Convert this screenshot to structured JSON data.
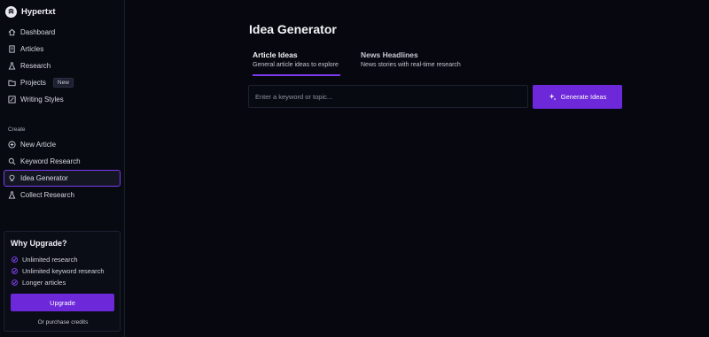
{
  "app": {
    "name": "Hypertxt"
  },
  "sidebar": {
    "main_items": [
      {
        "label": "Dashboard",
        "icon": "home-icon"
      },
      {
        "label": "Articles",
        "icon": "document-icon"
      },
      {
        "label": "Research",
        "icon": "flask-icon"
      },
      {
        "label": "Projects",
        "icon": "folder-icon",
        "badge": "New"
      },
      {
        "label": "Writing Styles",
        "icon": "pencil-icon"
      }
    ],
    "create_label": "Create",
    "create_items": [
      {
        "label": "New Article",
        "icon": "plus-circle-icon"
      },
      {
        "label": "Keyword Research",
        "icon": "search-icon"
      },
      {
        "label": "Idea Generator",
        "icon": "lightbulb-icon",
        "active": true
      },
      {
        "label": "Collect Research",
        "icon": "flask-icon"
      }
    ],
    "upgrade": {
      "title": "Why Upgrade?",
      "benefits": [
        "Unlimited research",
        "Unlimited keyword research",
        "Longer articles"
      ],
      "button": "Upgrade",
      "purchase_text": "Or purchase credits"
    }
  },
  "main": {
    "title": "Idea Generator",
    "tabs": [
      {
        "label": "Article Ideas",
        "description": "General article ideas to explore",
        "active": true
      },
      {
        "label": "News Headlines",
        "description": "News stories with real-time research",
        "active": false
      }
    ],
    "search": {
      "placeholder": "Enter a keyword or topic...",
      "value": ""
    },
    "generate_button": "Generate Ideas"
  },
  "colors": {
    "accent": "#6d28d9",
    "accent_border": "#7c3aed",
    "background": "#07080f",
    "sidebar": "#080a12"
  }
}
